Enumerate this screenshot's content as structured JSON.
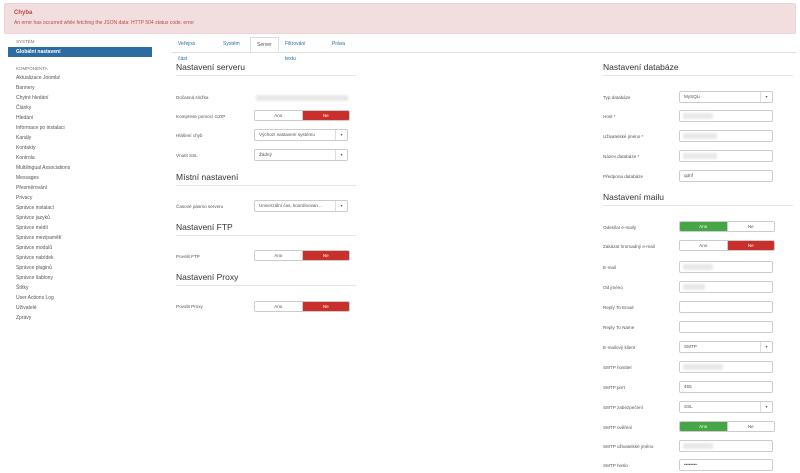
{
  "alert": {
    "title": "Chyba",
    "message": "An error has occurred while fetching the JSON data: HTTP 504 status code. error"
  },
  "sidebar": {
    "system_header": "SYSTÉM",
    "active_item": "Globální nastavení",
    "components_header": "KOMPONENTA",
    "items": [
      "Aktualizace Joomla!",
      "Bannery",
      "Chytré hledání",
      "Články",
      "Hledání",
      "Informace po instalaci",
      "Kanály",
      "Kontakty",
      "Kontrola",
      "Multilingual Associations",
      "Messages",
      "Přesměrování",
      "Privacy",
      "Správce instalací",
      "Správce jazyků",
      "Správce médií",
      "Správce mezipamětí",
      "Správce modulů",
      "Správce nabídek",
      "Správce pluginů",
      "Správce šablony",
      "Štítky",
      "User Actions Log",
      "Uživatelé",
      "Zprávy"
    ]
  },
  "tabs": [
    "Veřejná část",
    "Systém",
    "Server",
    "Filtrování textu",
    "Práva"
  ],
  "server": {
    "title": "Nastavení serveru",
    "temp_folder_label": "Dočasná složka",
    "gzip_label": "Komprese pomocí GZIP",
    "gzip": {
      "yes": "Ano",
      "no": "Ne"
    },
    "errors_label": "Hlášení chyb",
    "errors_value": "Výchozí nastavení systému",
    "ssl_label": "Vnutit SSL",
    "ssl_value": "Žádný"
  },
  "local": {
    "title": "Místní nastavení",
    "tz_label": "Časové pásmo serveru",
    "tz_value": "Univerzální čas, koordinovan..."
  },
  "ftp": {
    "title": "Nastavení FTP",
    "enable_label": "Povolit FTP",
    "toggle": {
      "yes": "Ano",
      "no": "Ne"
    }
  },
  "proxy": {
    "title": "Nastavení Proxy",
    "enable_label": "Povolit Proxy",
    "toggle": {
      "yes": "Ano",
      "no": "Ne"
    }
  },
  "database": {
    "title": "Nastavení databáze",
    "type_label": "Typ databáze",
    "type_value": "MySQLi",
    "host_label": "Host *",
    "user_label": "Uživatelské jméno *",
    "name_label": "Název databáze *",
    "prefix_label": "Předpona databáze",
    "prefix_value": "qdrif"
  },
  "mail": {
    "title": "Nastavení mailu",
    "send_label": "Odesílat e-maily",
    "send": {
      "yes": "Ano",
      "no": "Ne"
    },
    "mass_label": "Zakázat hromadný e-mail",
    "mass": {
      "yes": "Ano",
      "no": "Ne"
    },
    "from_email_label": "E-mail",
    "from_name_label": "Od jméno",
    "reply_email_label": "Reply To Email",
    "reply_name_label": "Reply To Name",
    "mailer_label": "E-mailový klient",
    "mailer_value": "SMTP",
    "smtp_host_label": "SMTP hostitel",
    "smtp_port_label": "SMTP port",
    "smtp_port_value": "465",
    "smtp_sec_label": "SMTP zabezpečení",
    "smtp_sec_value": "SSL",
    "smtp_auth_label": "SMTP ověření",
    "smtp_auth": {
      "yes": "Ano",
      "no": "Ne"
    },
    "smtp_user_label": "SMTP uživatelské jméno",
    "smtp_pass_label": "SMTP heslo",
    "smtp_pass_value": "••••••••"
  }
}
